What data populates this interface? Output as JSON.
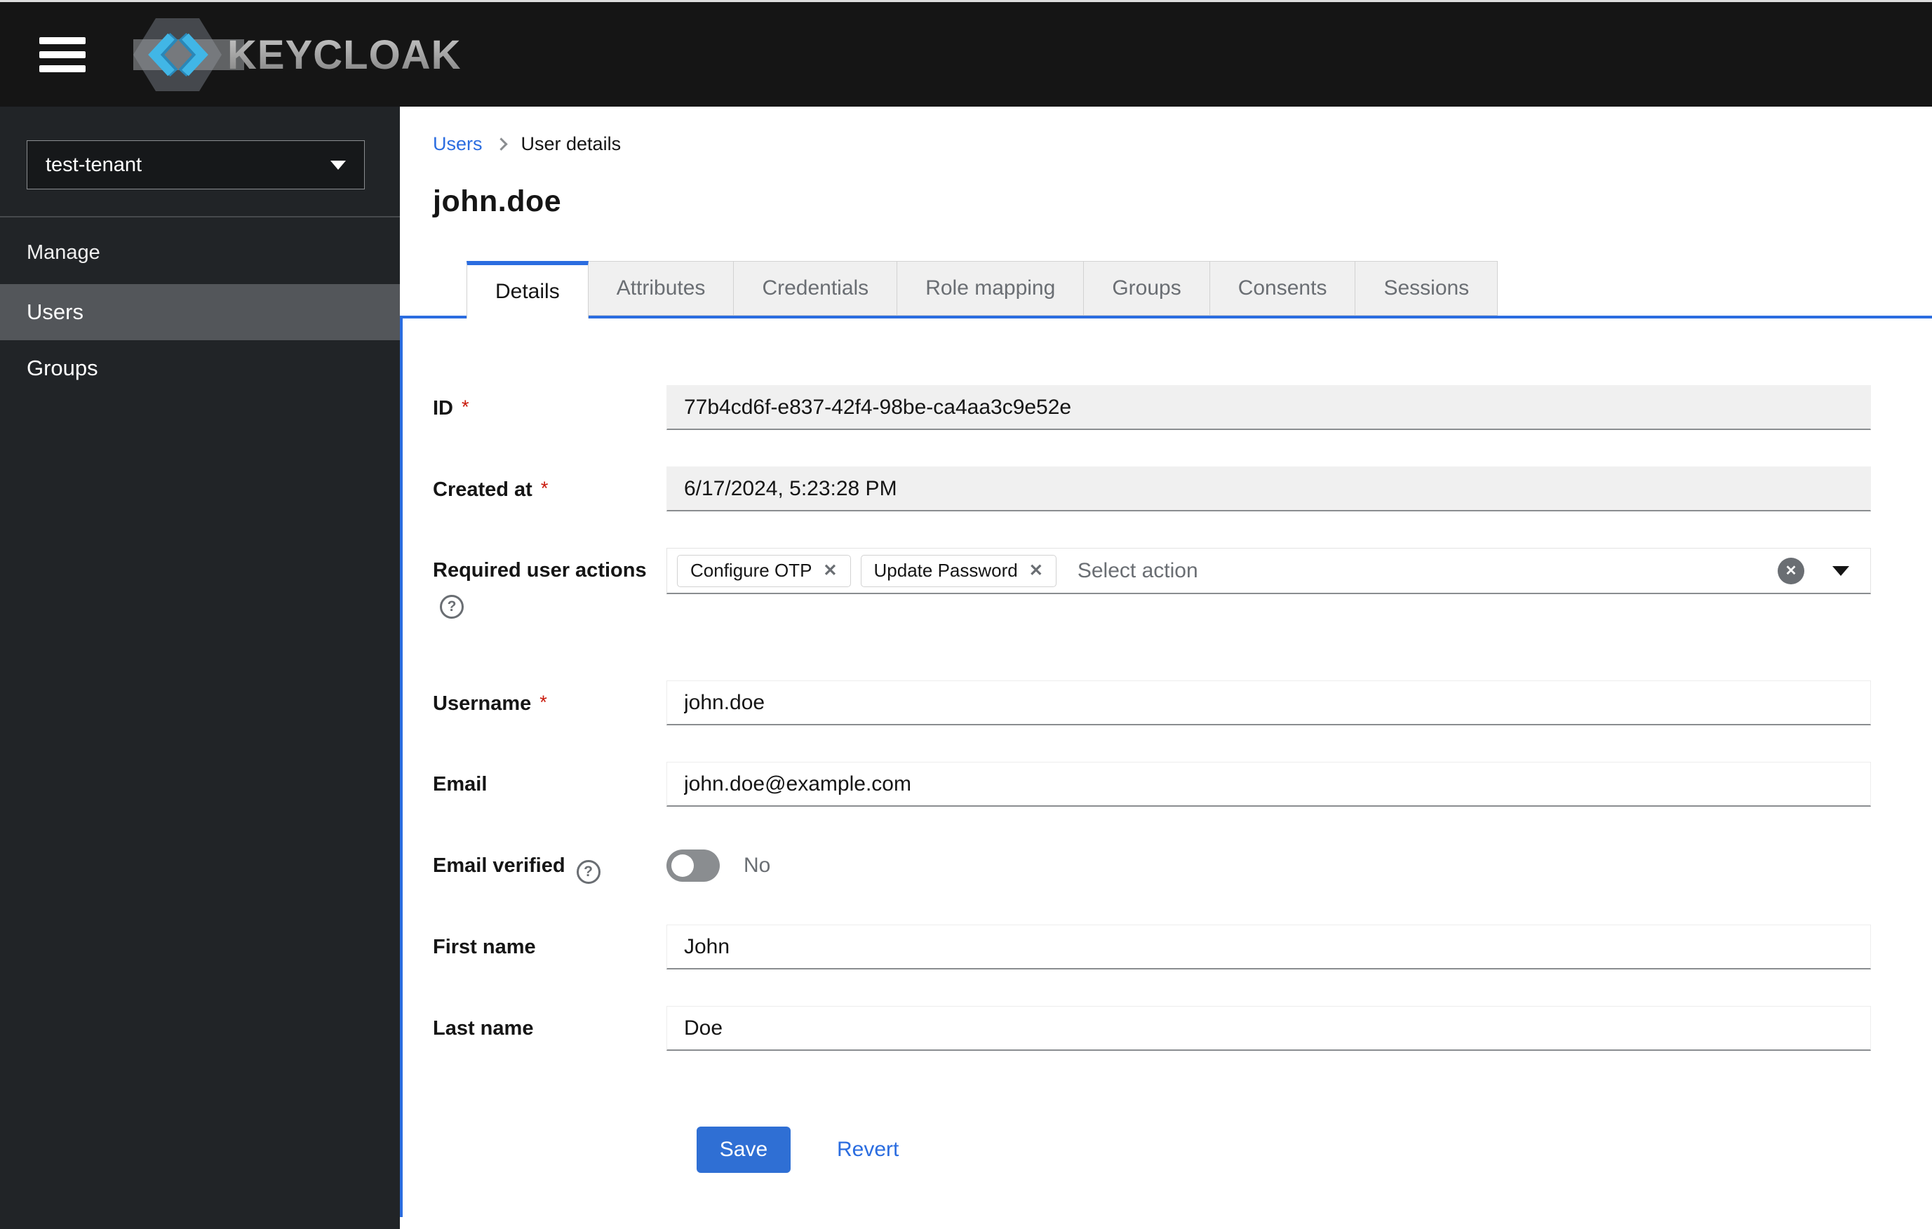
{
  "header": {
    "brand": "KEYCLOAK"
  },
  "sidebar": {
    "realm_selector": {
      "value": "test-tenant"
    },
    "section_label": "Manage",
    "items": [
      {
        "label": "Users",
        "active": true
      },
      {
        "label": "Groups",
        "active": false
      }
    ]
  },
  "breadcrumb": [
    {
      "label": "Users"
    },
    {
      "label": "User details"
    }
  ],
  "page": {
    "title": "john.doe"
  },
  "tabs": [
    {
      "label": "Details",
      "active": true
    },
    {
      "label": "Attributes",
      "active": false
    },
    {
      "label": "Credentials",
      "active": false
    },
    {
      "label": "Role mapping",
      "active": false
    },
    {
      "label": "Groups",
      "active": false
    },
    {
      "label": "Consents",
      "active": false
    },
    {
      "label": "Sessions",
      "active": false
    }
  ],
  "form": {
    "id": {
      "label": "ID",
      "required": true,
      "disabled": true,
      "value": "77b4cd6f-e837-42f4-98be-ca4aa3c9e52e"
    },
    "created_at": {
      "label": "Created at",
      "required": true,
      "disabled": true,
      "value": "6/17/2024, 5:23:28 PM"
    },
    "required_user_actions": {
      "label": "Required user actions",
      "chips": [
        "Configure OTP",
        "Update Password"
      ],
      "placeholder": "Select action"
    },
    "username": {
      "label": "Username",
      "required": true,
      "value": "john.doe"
    },
    "email": {
      "label": "Email",
      "value": "john.doe@example.com"
    },
    "email_verified": {
      "label": "Email verified",
      "state": "No",
      "on": false
    },
    "first_name": {
      "label": "First name",
      "value": "John"
    },
    "last_name": {
      "label": "Last name",
      "value": "Doe"
    }
  },
  "actions": {
    "save": "Save",
    "revert": "Revert"
  },
  "ui": {
    "required_marker": "*",
    "close_glyph": "✕",
    "help_glyph": "?"
  },
  "colors": {
    "header_bg": "#151515",
    "sidebar_bg": "#212427",
    "nav_active_bg": "#53565a",
    "accent_blue": "#2b6de0",
    "button_blue": "#2f6fd4",
    "required_red": "#c9190b",
    "muted_text": "#6a6e73",
    "input_disabled_bg": "#f0f0f0",
    "input_bottom_border": "#8a8d90"
  }
}
